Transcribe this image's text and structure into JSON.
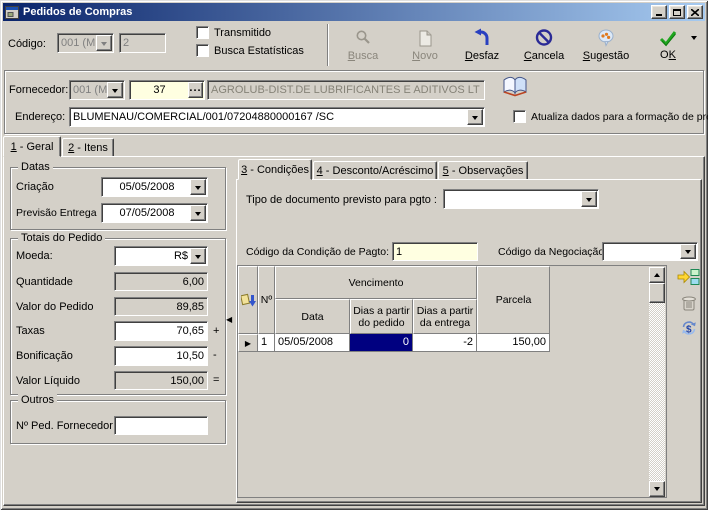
{
  "window": {
    "title": "Pedidos de Compras"
  },
  "header": {
    "codigo_label": "Código:",
    "codigo_combo": "001 (M",
    "codigo_value": "2",
    "checkbox_transmitido": "Transmitido",
    "checkbox_busca": "Busca Estatísticas"
  },
  "toolbar": {
    "buttons": [
      {
        "name": "busca",
        "pre": "",
        "m": "B",
        "post": "usca",
        "disabled": true
      },
      {
        "name": "novo",
        "pre": "",
        "m": "N",
        "post": "ovo",
        "disabled": true
      },
      {
        "name": "desfaz",
        "pre": "",
        "m": "D",
        "post": "esfaz",
        "disabled": false
      },
      {
        "name": "cancela",
        "pre": "",
        "m": "C",
        "post": "ancela",
        "disabled": false
      },
      {
        "name": "sugestao",
        "pre": "",
        "m": "S",
        "post": "ugestão",
        "disabled": false
      },
      {
        "name": "ok",
        "pre": "O",
        "m": "K",
        "post": "",
        "disabled": false
      }
    ]
  },
  "fornecedor": {
    "label": "Fornecedor:",
    "combo": "001 (M",
    "code": "37",
    "name": "AGROLUB-DIST.DE LUBRIFICANTES E ADITIVOS LT",
    "endereco_label": "Endereço:",
    "endereco": "BLUMENAU/COMERCIAL/001/07204880000167 /SC",
    "checkbox_atualiza": "Atualiza dados para a formação de preço"
  },
  "main_tabs": [
    {
      "m": "1",
      "rest": " - Geral"
    },
    {
      "m": "2",
      "rest": " - Itens"
    }
  ],
  "left": {
    "datas": {
      "title": "Datas",
      "criacao_label": "Criação",
      "criacao": "05/05/2008",
      "previsao_label": "Previsão Entrega",
      "previsao": "07/05/2008"
    },
    "totais": {
      "title": "Totais do Pedido",
      "moeda_label": "Moeda:",
      "moeda": "R$",
      "quantidade_label": "Quantidade",
      "quantidade": "6,00",
      "valor_pedido_label": "Valor do Pedido",
      "valor_pedido": "89,85",
      "taxas_label": "Taxas",
      "taxas": "70,65",
      "taxas_op": "+",
      "bonificacao_label": "Bonificação",
      "bonificacao": "10,50",
      "bonificacao_op": "-",
      "valor_liquido_label": "Valor Líquido",
      "valor_liquido": "150,00",
      "valor_liquido_op": "="
    },
    "outros": {
      "title": "Outros",
      "ped_label": "Nº Ped. Fornecedor",
      "ped_value": ""
    }
  },
  "right": {
    "tabs": [
      {
        "m": "3",
        "rest": " - Condições"
      },
      {
        "m": "4",
        "rest": " - Desconto/Acréscimo"
      },
      {
        "m": "5",
        "rest": " - Observações"
      }
    ],
    "tipo_doc_label": "Tipo de documento previsto para pgto :",
    "tipo_doc_value": "",
    "cond_label": "Código da Condição de Pagto:",
    "cond_value": "1",
    "negoc_label": "Código da Negociação:",
    "negoc_value": "",
    "grid": {
      "col_n": "Nº",
      "group_venc": "Vencimento",
      "col_data": "Data",
      "col_dias_pedido": "Dias a partir do pedido",
      "col_dias_pedido_l1": "Dias a partir",
      "col_dias_pedido_l2": "do pedido",
      "col_dias_entrega": "Dias a partir da entrega",
      "col_dias_entrega_l1": "Dias a partir",
      "col_dias_entrega_l2": "da entrega",
      "col_parcela": "Parcela",
      "rows": [
        {
          "n": "1",
          "data": "05/05/2008",
          "dias_pedido": "0",
          "dias_entrega": "-2",
          "parcela": "150,00"
        }
      ]
    }
  },
  "icons": {
    "row_indicator": "▶",
    "splitter_collapse": "◀",
    "ellipsis": "...",
    "more_arrow": "▼"
  },
  "colors": {
    "window_bg": "#D4D0C8",
    "titlebar_start": "#0A246A",
    "titlebar_end": "#A6CAF0",
    "selection": "#000080",
    "field_yellow": "#FFFFE1"
  }
}
